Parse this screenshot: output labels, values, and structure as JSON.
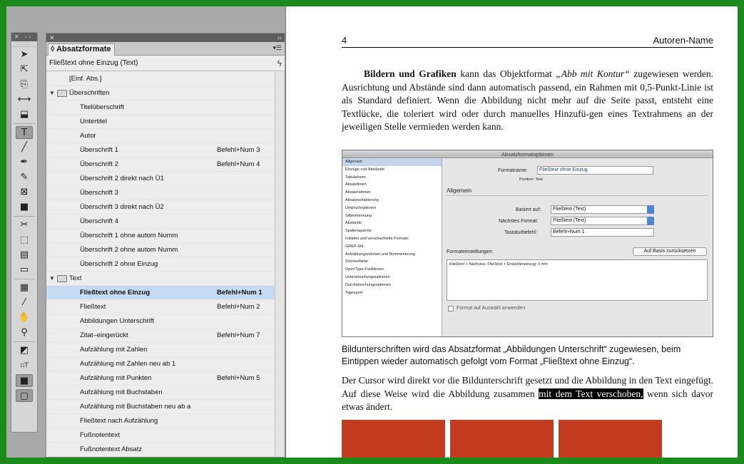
{
  "tools_panel": {
    "items": [
      "selection-tool",
      "direct-selection-tool",
      "page-tool",
      "gap-tool",
      "content-collector-tool",
      "type-tool",
      "line-tool",
      "pen-tool",
      "pencil-tool",
      "rectangle-frame-tool",
      "rectangle-tool",
      "scissors-tool",
      "free-transform-tool",
      "gradient-swatch-tool",
      "gradient-feather-tool",
      "note-tool",
      "eyedropper-tool",
      "hand-tool",
      "zoom-tool"
    ],
    "selected": "type-tool"
  },
  "styles_panel": {
    "tab_label": "Absatzformate",
    "current_style": "Fließtext ohne Einzug (Text)",
    "root_item": "[Einf. Abs.]",
    "groups": [
      {
        "name": "Überschriften",
        "items": [
          {
            "name": "Titelüberschrift",
            "shortcut": ""
          },
          {
            "name": "Untertitel",
            "shortcut": ""
          },
          {
            "name": "Autor",
            "shortcut": ""
          },
          {
            "name": "Überschrift 1",
            "shortcut": "Befehl+Num 3"
          },
          {
            "name": "Überschrift 2",
            "shortcut": "Befehl+Num 4"
          },
          {
            "name": "Überschrift 2 direkt nach Ü1",
            "shortcut": ""
          },
          {
            "name": "Überschrift 3",
            "shortcut": ""
          },
          {
            "name": "Überschrift 3 direkt nach Ü2",
            "shortcut": ""
          },
          {
            "name": "Überschrift 4",
            "shortcut": ""
          },
          {
            "name": "Überschrift 1 ohne autom Numm",
            "shortcut": ""
          },
          {
            "name": "Überschrift 2 ohne autom Numm",
            "shortcut": ""
          },
          {
            "name": "Überschrift 2 ohne Einzug",
            "shortcut": ""
          }
        ]
      },
      {
        "name": "Text",
        "items": [
          {
            "name": "Fließtext ohne Einzug",
            "shortcut": "Befehl+Num 1",
            "selected": true
          },
          {
            "name": "Fließtext",
            "shortcut": "Befehl+Num 2"
          },
          {
            "name": "Abbildungen Unterschrift",
            "shortcut": ""
          },
          {
            "name": "Zitat–eingerückt",
            "shortcut": "Befehl+Num 7"
          },
          {
            "name": "Aufzählung mit Zahlen",
            "shortcut": ""
          },
          {
            "name": "Aufzählung mit Zahlen neu ab 1",
            "shortcut": ""
          },
          {
            "name": "Aufzählung mit Punkten",
            "shortcut": "Befehl+Num 5"
          },
          {
            "name": "Aufzählung mit Buchstaben",
            "shortcut": ""
          },
          {
            "name": "Aufzählung mit Buchstaben neu ab a",
            "shortcut": ""
          },
          {
            "name": "Fließtext nach Aufzählung",
            "shortcut": ""
          },
          {
            "name": "Fußnotentext",
            "shortcut": ""
          },
          {
            "name": "Fußnotentext Absatz",
            "shortcut": ""
          }
        ]
      }
    ]
  },
  "document": {
    "page_number": "4",
    "author": "Autoren-Name",
    "p1_bold": "Bildern und Grafiken",
    "p1_a": " kann das Objektformat ",
    "p1_italic": "„Abb mit Kontur“",
    "p1_b": " zugewiesen werden. Ausrichtung und Abstände sind dann automatisch passend, ein Rahmen mit 0,5-Punkt-Linie ist als Standard definiert. Wenn die Abbildung nicht mehr auf die Seite passt, entsteht eine Textlücke, die toleriert wird oder durch manuelles Hinzufü-gen eines Textrahmens an der jeweiligen Stelle vermieden werden kann.",
    "caption": "Bildunterschriften wird das Absatzformat „Abbildungen Unterschrift“ zugewiesen, beim Eintippen wieder automatisch gefolgt vom Format „Fließtext ohne Einzug“.",
    "p2_a": "Der Cursor wird direkt vor die Bildunterschrift gesetzt und die Abbildung in den Text eingefügt. Auf diese Weise wird die Abbildung zusammen ",
    "p2_highlight": "mit dem Text verschoben,",
    "p2_b": " wenn sich davor etwas ändert.",
    "block_color": "#c23b1e"
  },
  "dialog_figure": {
    "title": "Absatzformatoptionen",
    "sidebar": [
      "Allgemein",
      "Einzüge und Abstände",
      "Tabulatoren",
      "Absatzlinien",
      "Absatzrahmen",
      "Absatzschattierung",
      "Umbruchoptionen",
      "Silbentrennung",
      "Abstände",
      "Spaltenspanne",
      "Initialen und verschachtelte Formate",
      "GREP-Stil",
      "Aufzählungszeichen und Nummerierung",
      "Zeichenfarbe",
      "OpenType-Funktionen",
      "Unterstreichungsoptionen",
      "Durchstreichungsoptionen",
      "Tagexport"
    ],
    "format_name_label": "Formatname:",
    "format_name_value": "Fließtext ohne Einzug",
    "position_label": "Position: Text",
    "section_label": "Allgemein",
    "based_on_label": "Basiert auf:",
    "based_on_value": "Fließtext (Text)",
    "next_label": "Nächstes Format:",
    "next_value": "Fließtext (Text)",
    "shortcut_label": "Tastaturbefehl:",
    "shortcut_value": "Befehl+Num 1",
    "settings_label": "Formateinstellungen:",
    "reset_button": "Auf Basis zurücksetzen",
    "settings_text": "Fließtext + Nächstes: Fließtext + Erstzeileneinzug: 0 mm",
    "apply_checkbox": "Format auf Auswahl anwenden"
  }
}
